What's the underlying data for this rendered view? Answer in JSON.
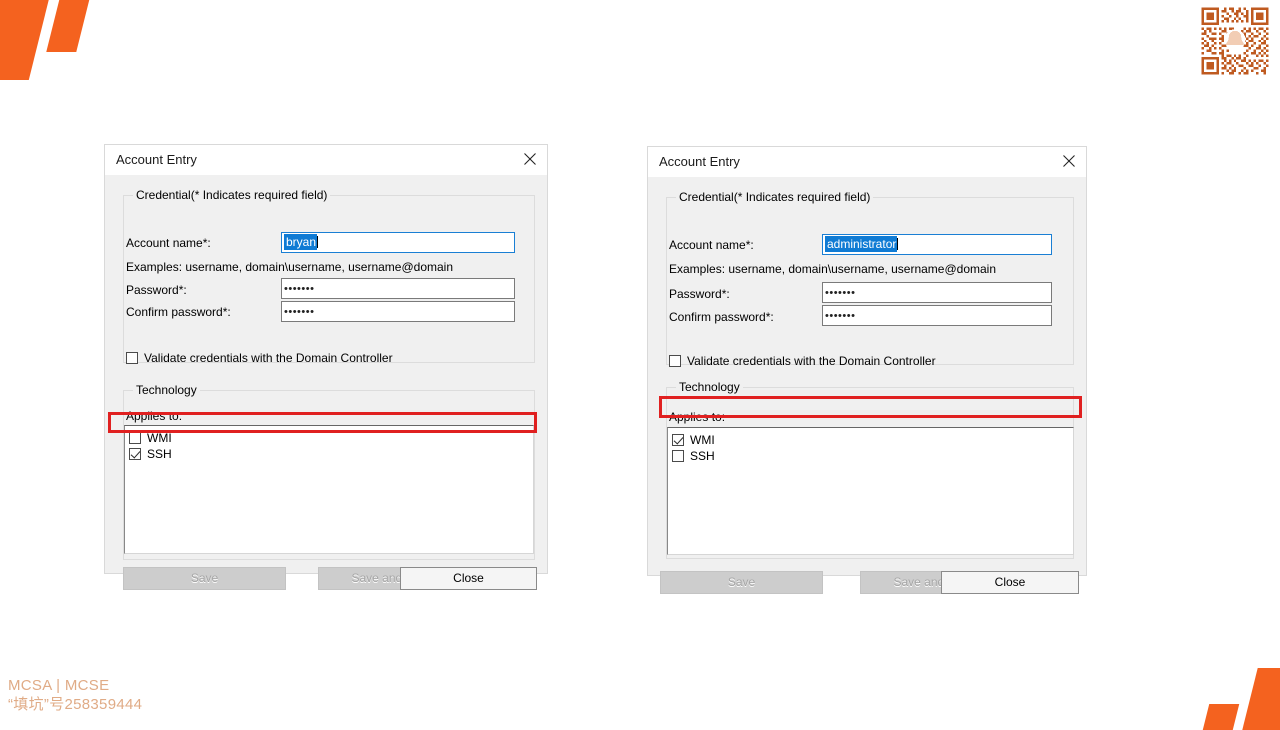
{
  "branding": {
    "accent_color": "#f4621f",
    "watermark_color": "#e0ab86",
    "watermark_line1": "MCSA | MCSE",
    "watermark_line2": "“填坑”号258359444",
    "qr_color": "#bf5a20"
  },
  "annotation": {
    "highlight_color": "#e02020"
  },
  "dialogs": [
    {
      "id": "left",
      "title": "Account Entry",
      "close_icon": "close-icon",
      "credential": {
        "legend": "Credential(* Indicates required field)",
        "account_name_label": "Account name*:",
        "account_name_value": "bryan",
        "account_name_placeholder": "",
        "examples": "Examples: username, domain\\username, username@domain",
        "password_label": "Password*:",
        "password_value": "•••••••",
        "confirm_password_label": "Confirm password*:",
        "confirm_password_value": "•••••••",
        "validate_label": "Validate credentials with the Domain Controller",
        "validate_checked": false
      },
      "technology": {
        "legend": "Technology",
        "applies_to_label": "Applies to:",
        "items": [
          {
            "label": "WMI",
            "checked": false,
            "highlighted": false
          },
          {
            "label": "SSH",
            "checked": true,
            "highlighted": true
          }
        ]
      },
      "buttons": {
        "save": {
          "label": "Save",
          "enabled": false
        },
        "save_and_new": {
          "label": "Save and New",
          "enabled": false
        },
        "close": {
          "label": "Close",
          "enabled": true
        }
      }
    },
    {
      "id": "right",
      "title": "Account Entry",
      "close_icon": "close-icon",
      "credential": {
        "legend": "Credential(* Indicates required field)",
        "account_name_label": "Account name*:",
        "account_name_value": "administrator",
        "account_name_placeholder": "",
        "examples": "Examples: username, domain\\username, username@domain",
        "password_label": "Password*:",
        "password_value": "•••••••",
        "confirm_password_label": "Confirm password*:",
        "confirm_password_value": "•••••••",
        "validate_label": "Validate credentials with the Domain Controller",
        "validate_checked": false
      },
      "technology": {
        "legend": "Technology",
        "applies_to_label": "Applies to:",
        "items": [
          {
            "label": "WMI",
            "checked": true,
            "highlighted": true
          },
          {
            "label": "SSH",
            "checked": false,
            "highlighted": false
          }
        ]
      },
      "buttons": {
        "save": {
          "label": "Save",
          "enabled": false
        },
        "save_and_new": {
          "label": "Save and New",
          "enabled": false
        },
        "close": {
          "label": "Close",
          "enabled": true
        }
      }
    }
  ]
}
